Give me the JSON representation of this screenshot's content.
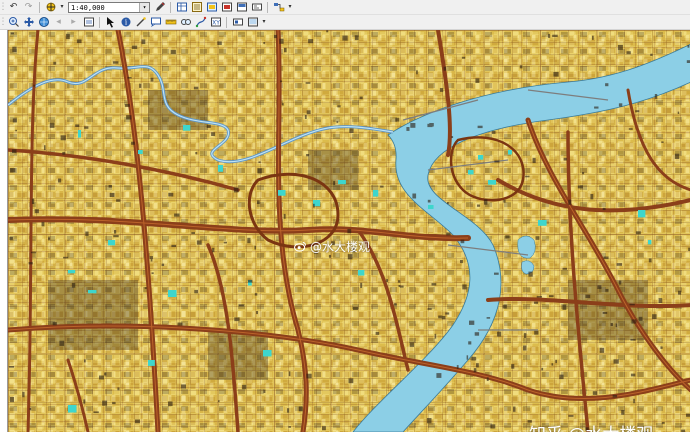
{
  "toolbar": {
    "scale_value": "1:40,000",
    "scale_placeholder": "Scale"
  },
  "map": {
    "land_color": "#e8cf6a",
    "road_color": "#8b3f1a",
    "water_color": "#8ccfe6",
    "park_color": "#3ed6cc",
    "river_label": "",
    "watermark_center": "@水大楼观",
    "watermark_bottom": "知乎 @水大楼观"
  },
  "icons": [
    "undo-icon",
    "redo-icon",
    "add-data-icon",
    "scale-dropdown-icon",
    "editor-icon",
    "table-icon",
    "toc-icon",
    "catalog-icon",
    "search-icon",
    "arcgis-icon",
    "layout-icon",
    "python-icon",
    "zoom-in-icon",
    "zoom-out-icon",
    "pan-icon",
    "full-extent-icon",
    "select-icon",
    "identify-icon",
    "find-icon",
    "measure-icon",
    "hyperlink-icon",
    "html-popup-icon",
    "time-slider-icon",
    "viewer-icon"
  ]
}
